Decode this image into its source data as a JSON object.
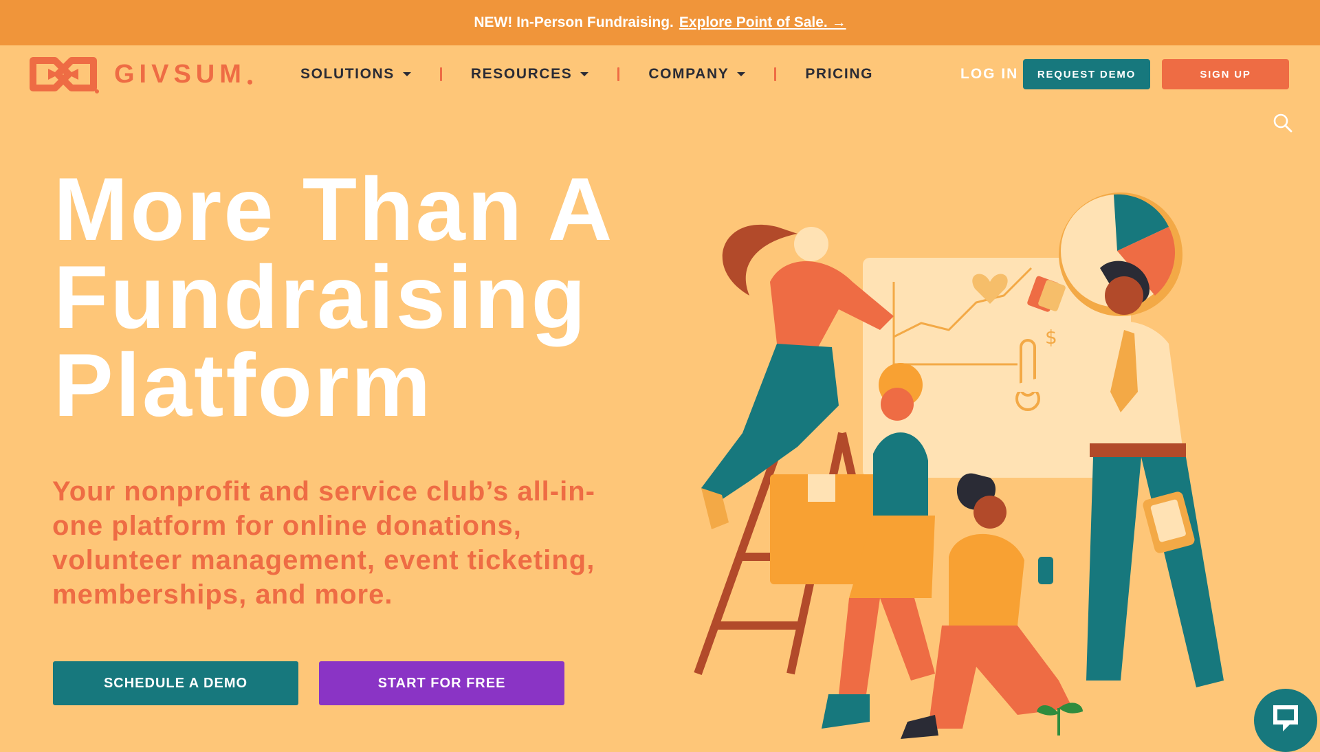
{
  "announcement": {
    "text": "NEW! In-Person Fundraising.",
    "link": "Explore Point of Sale. →"
  },
  "header": {
    "logo_text": "GIVSUM",
    "nav": [
      {
        "label": "SOLUTIONS",
        "dropdown": true
      },
      {
        "label": "RESOURCES",
        "dropdown": true
      },
      {
        "label": "COMPANY",
        "dropdown": true
      },
      {
        "label": "PRICING",
        "dropdown": false
      }
    ],
    "login_label": "LOG IN",
    "request_demo_label": "REQUEST DEMO",
    "signup_label": "SIGN UP",
    "search_icon": "search-icon"
  },
  "hero": {
    "title_lines": [
      "More Than A",
      "Fundraising",
      "Platform"
    ],
    "subtitle": "Your nonprofit and service club’s all-in-one platform for online donations, volunteer management, event ticketing, memberships, and more.",
    "primary_cta": "SCHEDULE A DEMO",
    "secondary_cta": "START FOR FREE"
  },
  "chat": {
    "icon": "chat-bubble-icon"
  },
  "colors": {
    "page_bg": "#FEC678",
    "announcement_bg": "#F0953A",
    "brand_orange": "#EE6C44",
    "teal": "#17787D",
    "purple": "#8A34C5",
    "dark_text": "#2A2B35"
  }
}
